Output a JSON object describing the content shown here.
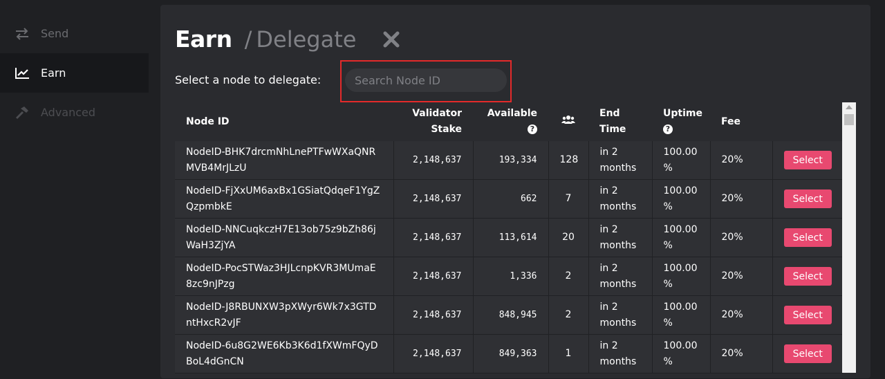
{
  "sidebar": {
    "items": [
      {
        "label": "Send",
        "icon": "transfer-arrows-icon"
      },
      {
        "label": "Earn",
        "icon": "chart-line-icon"
      },
      {
        "label": "Advanced",
        "icon": "hammer-icon"
      }
    ]
  },
  "header": {
    "title": "Earn",
    "separator": "/",
    "subtitle": "Delegate"
  },
  "search": {
    "label": "Select a node to delegate:",
    "placeholder": "Search Node ID",
    "value": ""
  },
  "table": {
    "columns": {
      "node_id": "Node ID",
      "validator_stake_1": "Validator",
      "validator_stake_2": "Stake",
      "available": "Available",
      "end_time_1": "End",
      "end_time_2": "Time",
      "uptime": "Uptime",
      "fee": "Fee"
    },
    "select_label": "Select",
    "rows": [
      {
        "node_id": "NodeID-BHK7drcmNhLnePTFwWXaQNRMVB4MrJLzU",
        "stake": "2,148,637",
        "available": "193,334",
        "delegators": "128",
        "end_time": "in 2 months",
        "uptime": "100.00 %",
        "fee": "20%"
      },
      {
        "node_id": "NodeID-FjXxUM6axBx1GSiatQdqeF1YgZQzpmbkE",
        "stake": "2,148,637",
        "available": "662",
        "delegators": "7",
        "end_time": "in 2 months",
        "uptime": "100.00 %",
        "fee": "20%"
      },
      {
        "node_id": "NodeID-NNCuqkczH7E13ob75z9bZh86jWaH3ZjYA",
        "stake": "2,148,637",
        "available": "113,614",
        "delegators": "20",
        "end_time": "in 2 months",
        "uptime": "100.00 %",
        "fee": "20%"
      },
      {
        "node_id": "NodeID-PocSTWaz3HJLcnpKVR3MUmaE8zc9nJPzg",
        "stake": "2,148,637",
        "available": "1,336",
        "delegators": "2",
        "end_time": "in 2 months",
        "uptime": "100.00 %",
        "fee": "20%"
      },
      {
        "node_id": "NodeID-J8RBUNXW3pXWyr6Wk7x3GTDntHxcR2vJF",
        "stake": "2,148,637",
        "available": "848,945",
        "delegators": "2",
        "end_time": "in 2 months",
        "uptime": "100.00 %",
        "fee": "20%"
      },
      {
        "node_id": "NodeID-6u8G2WE6Kb3K6d1fXWmFQyDBoL4dGnCN",
        "stake": "2,148,637",
        "available": "849,363",
        "delegators": "1",
        "end_time": "in 2 months",
        "uptime": "100.00 %",
        "fee": "20%"
      }
    ]
  },
  "colors": {
    "accent": "#e84970",
    "highlight": "#e42a2a",
    "panel": "#2a2b2f",
    "sidebar_active": "#17181b"
  }
}
